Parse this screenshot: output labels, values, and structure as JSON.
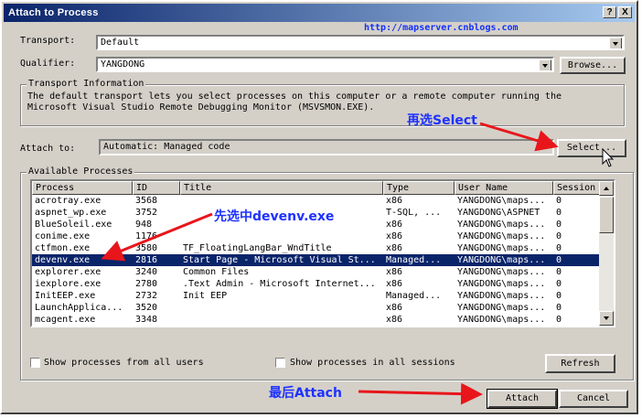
{
  "window": {
    "title": "Attach to Process",
    "help_btn": "?",
    "close_btn": "X",
    "watermark": "http://mapserver.cnblogs.com"
  },
  "transport": {
    "label": "Transport:",
    "value": "Default"
  },
  "qualifier": {
    "label": "Qualifier:",
    "value": "YANGDONG",
    "browse_label": "Browse..."
  },
  "transport_info": {
    "title": "Transport Information",
    "line1": "The default transport lets you select processes on this computer or a remote computer running the",
    "line2": "Microsoft Visual Studio Remote Debugging Monitor (MSVSMON.EXE)."
  },
  "attach_to": {
    "label": "Attach to:",
    "value": "Automatic: Managed code",
    "select_label": "Select..."
  },
  "processes": {
    "title": "Available Processes",
    "columns": [
      "Process",
      "ID",
      "Title",
      "Type",
      "User Name",
      "Session"
    ],
    "rows": [
      [
        "acrotray.exe",
        "3568",
        "",
        "x86",
        "YANGDONG\\maps...",
        "0"
      ],
      [
        "aspnet_wp.exe",
        "3752",
        "",
        "T-SQL, ...",
        "YANGDONG\\ASPNET",
        "0"
      ],
      [
        "BlueSoleil.exe",
        "948",
        "",
        "x86",
        "YANGDONG\\maps...",
        "0"
      ],
      [
        "conime.exe",
        "1176",
        "",
        "x86",
        "YANGDONG\\maps...",
        "0"
      ],
      [
        "ctfmon.exe",
        "3580",
        "TF_FloatingLangBar_WndTitle",
        "x86",
        "YANGDONG\\maps...",
        "0"
      ],
      [
        "devenv.exe",
        "2816",
        "Start Page - Microsoft Visual St...",
        "Managed...",
        "YANGDONG\\maps...",
        "0"
      ],
      [
        "explorer.exe",
        "3240",
        "Common Files",
        "x86",
        "YANGDONG\\maps...",
        "0"
      ],
      [
        "iexplore.exe",
        "2780",
        ".Text Admin - Microsoft Internet...",
        "x86",
        "YANGDONG\\maps...",
        "0"
      ],
      [
        "InitEEP.exe",
        "2732",
        "Init EEP",
        "Managed...",
        "YANGDONG\\maps...",
        "0"
      ],
      [
        "LaunchApplica...",
        "3520",
        "",
        "x86",
        "YANGDONG\\maps...",
        "0"
      ],
      [
        "mcagent.exe",
        "3348",
        "",
        "x86",
        "YANGDONG\\maps...",
        "0"
      ]
    ],
    "selected_index": 5
  },
  "options": {
    "all_users": "Show processes from all users",
    "all_sessions": "Show processes in all sessions",
    "refresh_label": "Refresh"
  },
  "footer": {
    "attach_label": "Attach",
    "cancel_label": "Cancel"
  },
  "annotations": {
    "select_note": "再选Select",
    "devenv_note": "先选中devenv.exe",
    "attach_note": "最后Attach",
    "color_text": "#1e32ff",
    "color_arrow": "#e8161b"
  }
}
